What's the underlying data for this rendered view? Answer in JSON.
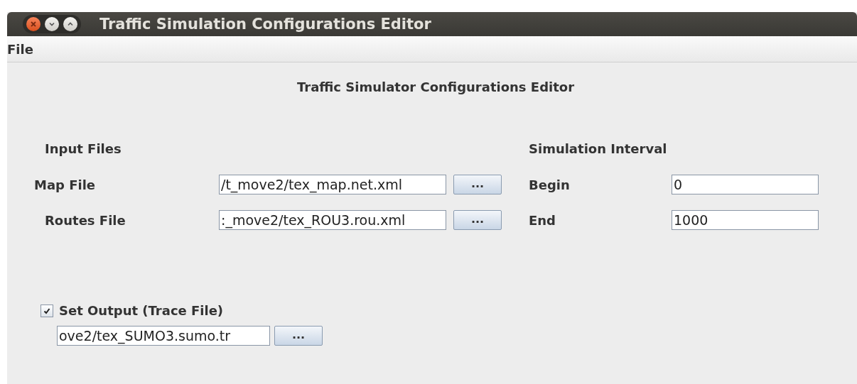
{
  "window": {
    "title": "Traffic Simulation Configurations Editor",
    "controls": [
      {
        "kind": "close"
      },
      {
        "kind": "minimize"
      },
      {
        "kind": "maximize"
      }
    ]
  },
  "menu": [
    "File"
  ],
  "heading": "Traffic Simulator Configurations Editor",
  "input_files": {
    "title": "Input Files",
    "rows": [
      {
        "label": "Map File",
        "value": "/t_move2/tex_map.net.xml",
        "button": "..."
      },
      {
        "label": "Routes File",
        "value": ":_move2/tex_ROU3.rou.xml",
        "button": "..."
      }
    ]
  },
  "simulation_interval": {
    "title": "Simulation Interval",
    "rows": [
      {
        "label": "Begin",
        "value": "0"
      },
      {
        "label": "End",
        "value": "1000"
      }
    ]
  },
  "output": {
    "label": "Set Output (Trace File)",
    "checked": true,
    "value": "ove2/tex_SUMO3.sumo.tr",
    "button": "..."
  }
}
